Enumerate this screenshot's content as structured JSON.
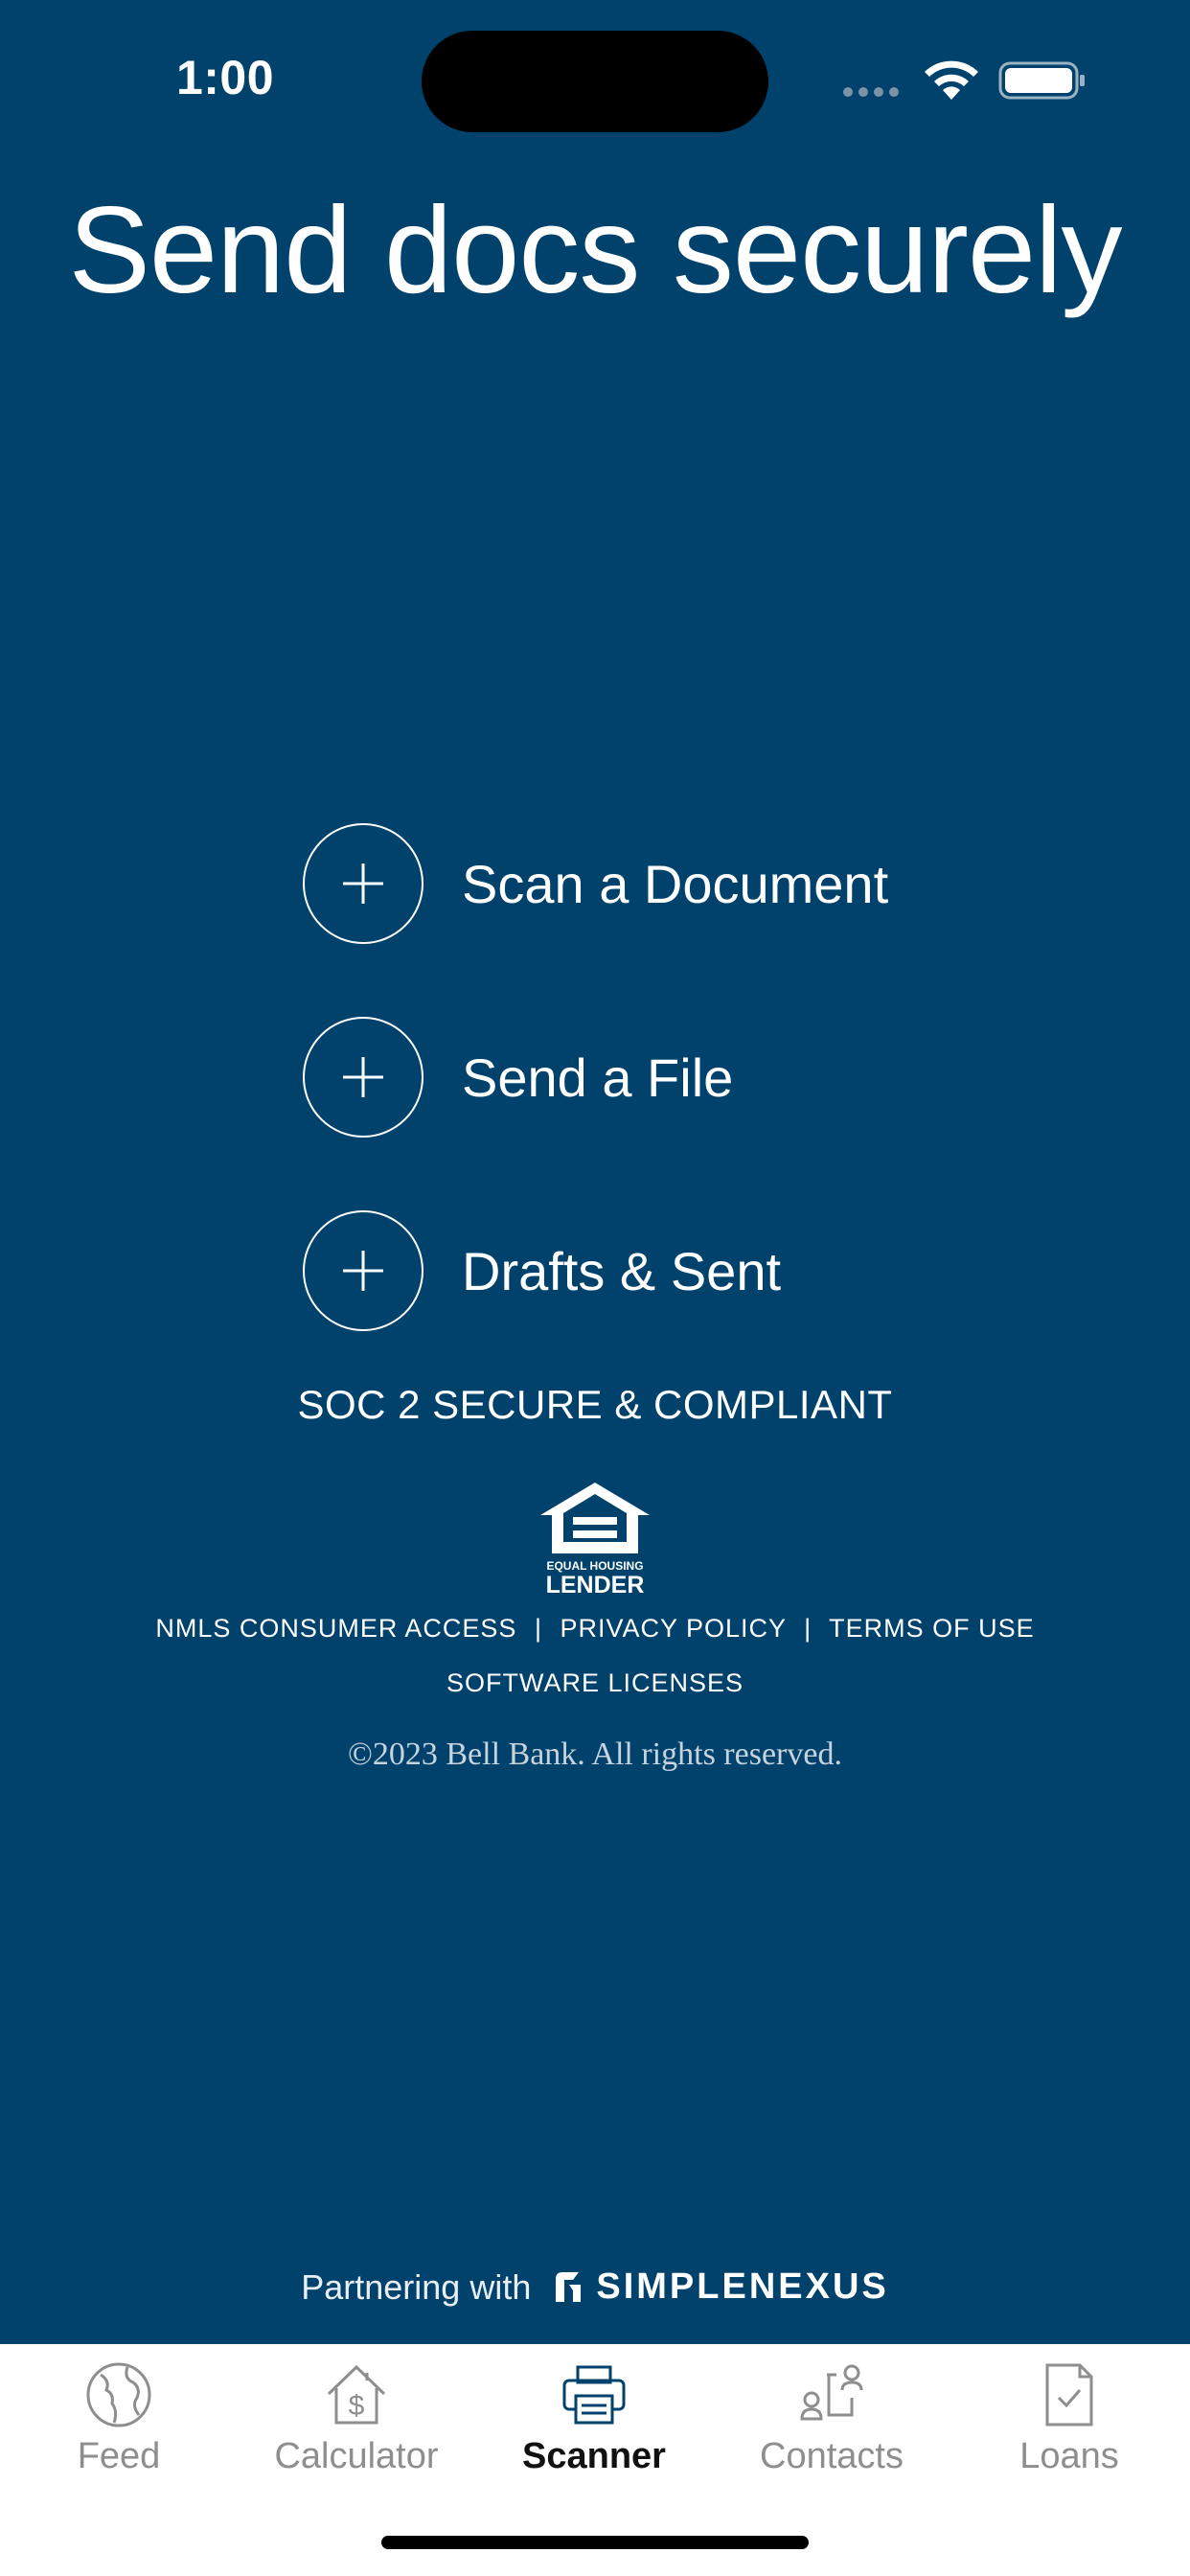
{
  "status_bar": {
    "time": "1:00"
  },
  "title": "Send docs securely",
  "actions": [
    {
      "label": "Scan a Document",
      "icon": "plus-icon"
    },
    {
      "label": "Send a File",
      "icon": "plus-icon"
    },
    {
      "label": "Drafts & Sent",
      "icon": "plus-icon"
    }
  ],
  "compliance": "SOC 2 SECURE & COMPLIANT",
  "equal_housing": {
    "line1": "EQUAL HOUSING",
    "line2": "LENDER"
  },
  "links": {
    "nmls": "NMLS CONSUMER ACCESS",
    "privacy": "PRIVACY POLICY",
    "terms": "TERMS OF USE",
    "separator": "|",
    "software": "SOFTWARE LICENSES"
  },
  "copyright": "©2023 Bell Bank. All rights reserved.",
  "partner": {
    "text": "Partnering with",
    "brand": "SIMPLENEXUS"
  },
  "tabs": [
    {
      "label": "Feed",
      "icon": "globe-icon",
      "active": false
    },
    {
      "label": "Calculator",
      "icon": "house-dollar-icon",
      "active": false
    },
    {
      "label": "Scanner",
      "icon": "printer-icon",
      "active": true
    },
    {
      "label": "Contacts",
      "icon": "contacts-icon",
      "active": false
    },
    {
      "label": "Loans",
      "icon": "document-check-icon",
      "active": false
    }
  ],
  "colors": {
    "background": "#00426B",
    "tab_active": "#00426B",
    "tab_inactive": "#8E8E8E"
  }
}
